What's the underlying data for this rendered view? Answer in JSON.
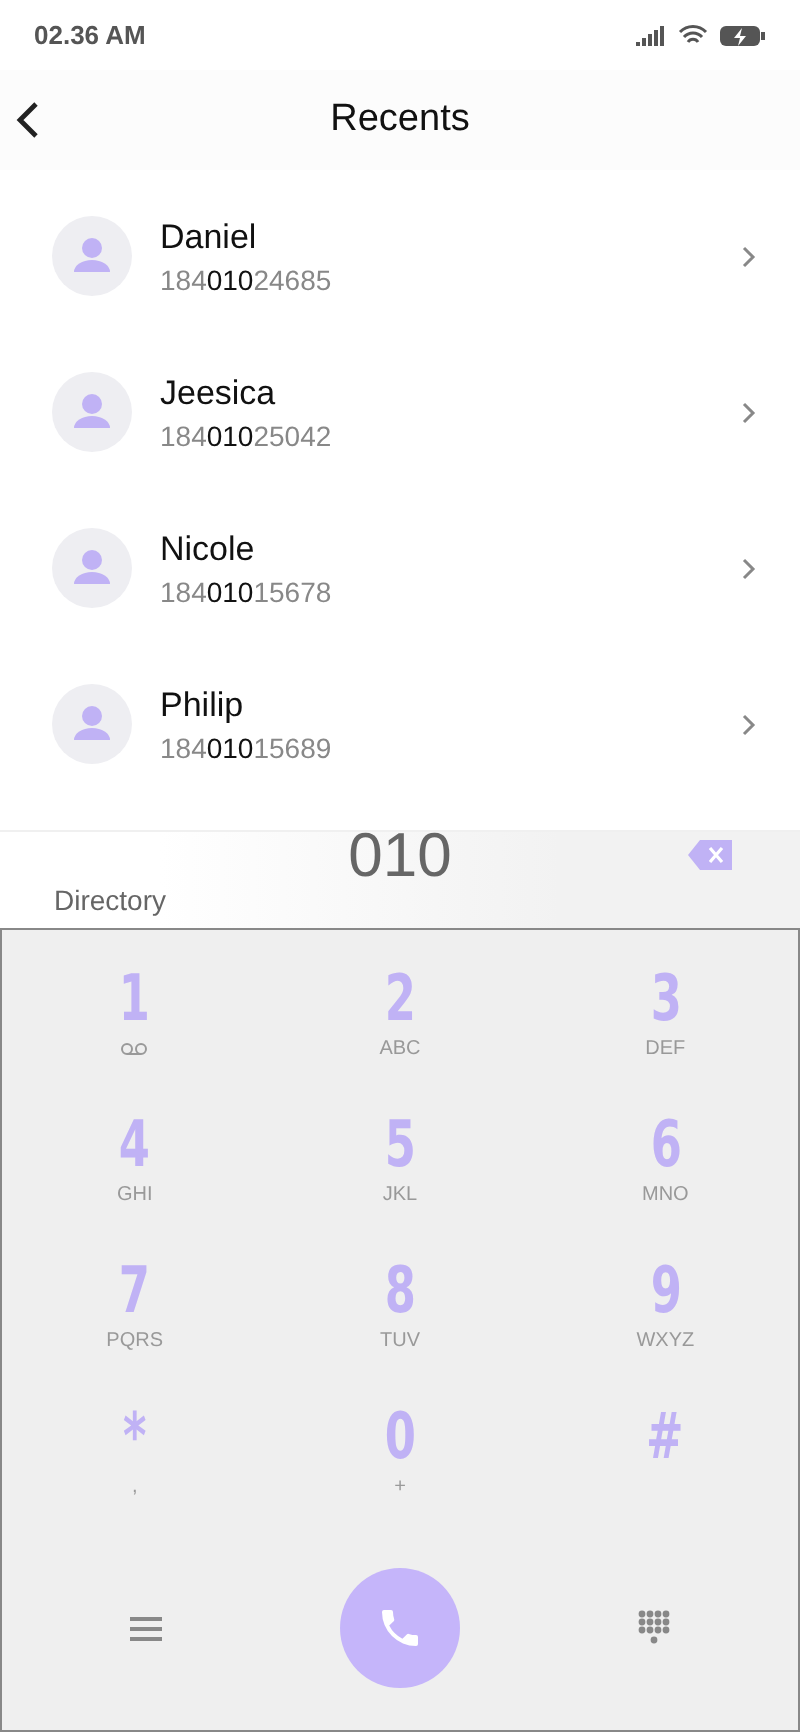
{
  "status_bar": {
    "time": "02.36 AM"
  },
  "header": {
    "title": "Recents"
  },
  "contacts": [
    {
      "name": "Daniel",
      "number": "184**010**24685"
    },
    {
      "name": "Jeesica",
      "number": "184**010**25042"
    },
    {
      "name": "Nicole",
      "number": "184**010**15678"
    },
    {
      "name": "Philip",
      "number": "184**010**15689"
    }
  ],
  "dial": {
    "label": "Directory",
    "value": "010"
  },
  "keys": [
    {
      "digit": "1",
      "kind": "voicemail"
    },
    {
      "digit": "2",
      "kind": "letters",
      "letters": "ABC"
    },
    {
      "digit": "3",
      "kind": "letters",
      "letters": "DEF"
    },
    {
      "digit": "4",
      "kind": "letters",
      "letters": "GHI"
    },
    {
      "digit": "5",
      "kind": "letters",
      "letters": "JKL"
    },
    {
      "digit": "6",
      "kind": "letters",
      "letters": "MNO"
    },
    {
      "digit": "7",
      "kind": "letters",
      "letters": "PQRS"
    },
    {
      "digit": "8",
      "kind": "letters",
      "letters": "TUV"
    },
    {
      "digit": "9",
      "kind": "letters",
      "letters": "WXYZ"
    },
    {
      "digit": "*",
      "kind": "letters",
      "letters": ","
    },
    {
      "digit": "0",
      "kind": "letters",
      "letters": "+"
    },
    {
      "digit": "#",
      "kind": "none"
    }
  ]
}
